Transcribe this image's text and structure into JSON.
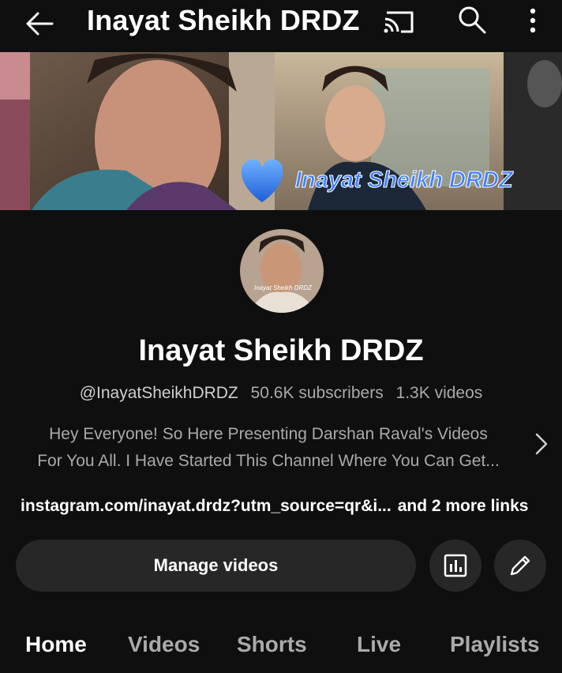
{
  "header": {
    "title": "Inayat Sheikh DRDZ",
    "icons": [
      "back-arrow-icon",
      "cast-icon",
      "search-icon",
      "more-vert-icon"
    ]
  },
  "banner": {
    "overlay_text": "Inayat Sheikh DRDZ",
    "heart_color": "#2f7df6"
  },
  "avatar": {
    "watermark_text": "Inayat Sheikh DRDZ"
  },
  "channel": {
    "name": "Inayat Sheikh DRDZ",
    "handle": "@InayatSheikhDRDZ",
    "subscribers": "50.6K subscribers",
    "videos": "1.3K videos",
    "description_line1": "Hey Everyone! So Here Presenting Darshan Raval's Videos",
    "description_line2": "For You All. I Have Started This Channel Where You Can Get...",
    "link": "instagram.com/inayat.drdz?utm_source=qr&i...",
    "more_links": "and 2 more links"
  },
  "actions": {
    "manage_videos": "Manage videos"
  },
  "tabs": [
    "Home",
    "Videos",
    "Shorts",
    "Live",
    "Playlists"
  ],
  "colors": {
    "background": "#0f0f0f",
    "button": "#272727",
    "secondary_text": "#aaaaaa"
  }
}
